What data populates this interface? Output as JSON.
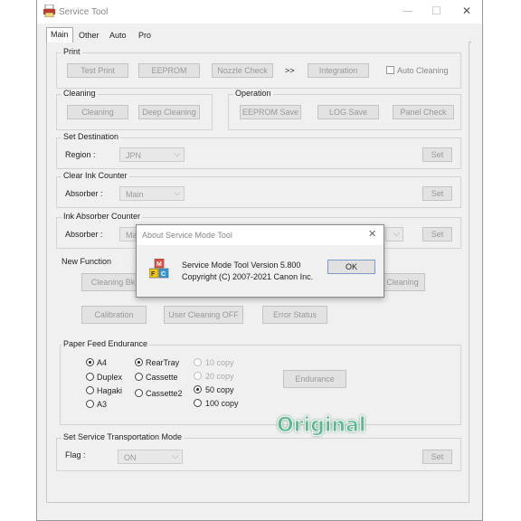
{
  "window": {
    "title": "Service Tool",
    "minimize": "—",
    "maximize": "☐",
    "close": "✕"
  },
  "tabs": [
    "Main",
    "Other",
    "Auto",
    "Pro"
  ],
  "print": {
    "label": "Print",
    "test_print": "Test Print",
    "eeprom": "EEPROM",
    "nozzle_check": "Nozzle Check",
    "arrows": ">>",
    "integration": "Integration",
    "auto_cleaning": "Auto Cleaning"
  },
  "cleaning": {
    "label": "Cleaning",
    "cleaning": "Cleaning",
    "deep_cleaning": "Deep Cleaning"
  },
  "operation": {
    "label": "Operation",
    "eeprom_save": "EEPROM Save",
    "log_save": "LOG Save",
    "panel_check": "Panel Check"
  },
  "set_destination": {
    "label": "Set Destination",
    "region_label": "Region :",
    "region_value": "JPN",
    "set": "Set"
  },
  "clear_ink": {
    "label": "Clear Ink Counter",
    "absorber_label": "Absorber :",
    "absorber_value": "Main",
    "set": "Set"
  },
  "ink_absorber": {
    "label": "Ink Absorber Counter",
    "absorber_label": "Absorber :",
    "absorber_value": "Mai",
    "set": "Set"
  },
  "new_function": {
    "label": "New Function",
    "cleaning_bk": "Cleaning Bk",
    "cleaning_right": "Cleaning",
    "calibration": "Calibration",
    "user_cleaning_off": "User Cleaning OFF",
    "error_status": "Error Status"
  },
  "paper_feed": {
    "label": "Paper Feed Endurance",
    "sizes": [
      "A4",
      "Duplex",
      "Hagaki",
      "A3"
    ],
    "trays": [
      "RearTray",
      "Cassette",
      "Cassette2"
    ],
    "copies": [
      "10 copy",
      "20 copy",
      "50 copy",
      "100 copy"
    ],
    "endurance": "Endurance"
  },
  "transport": {
    "label": "Set Service Transportation Mode",
    "flag_label": "Flag :",
    "flag_value": "ON",
    "set": "Set"
  },
  "dialog": {
    "title": "About Service Mode Tool",
    "close": "✕",
    "line1": "Service Mode Tool  Version 5.800",
    "line2": "Copyright (C) 2007-2021 Canon Inc.",
    "ok": "OK",
    "icon_letters": [
      "M",
      "F",
      "C"
    ]
  },
  "watermark": "Original",
  "combo_arrow": "⌵"
}
